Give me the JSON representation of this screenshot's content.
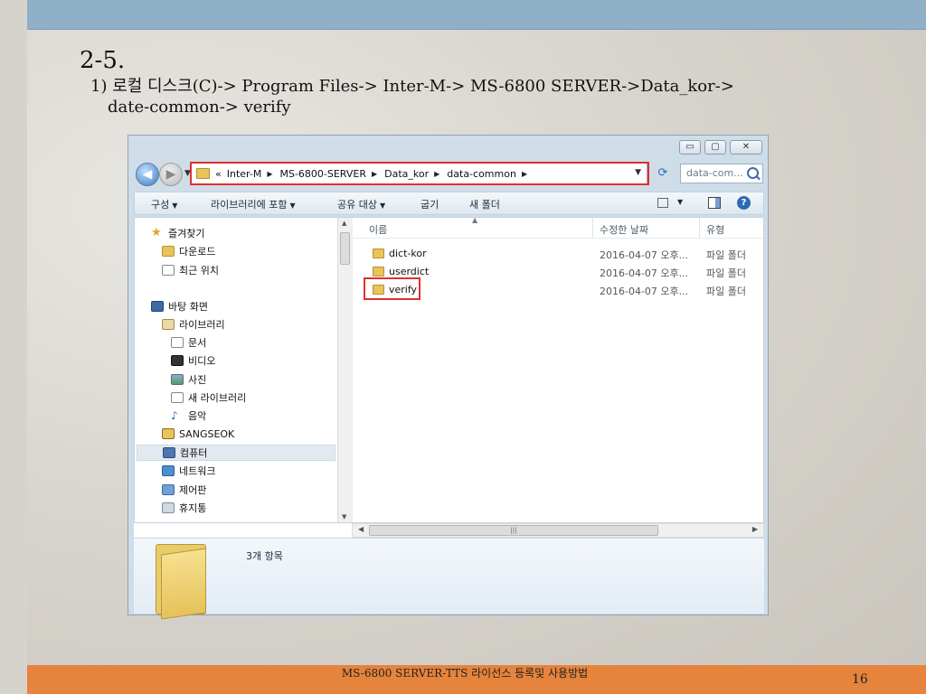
{
  "slide": {
    "title": "2-5.",
    "subtitle_line1": "1) 로컬 디스크(C)-> Program Files-> Inter-M-> MS-6800 SERVER->Data_kor->",
    "subtitle_line2": "date-common-> verify",
    "footer": "MS-6800 SERVER-TTS 라이선스 등록및 사용방법",
    "page_number": "16"
  },
  "explorer": {
    "window_controls": {
      "minimize": "▭",
      "maximize": "▢",
      "close": "✕"
    },
    "address": {
      "prefix": "«",
      "crumbs": [
        "Inter-M",
        "MS-6800-SERVER",
        "Data_kor",
        "data-common"
      ]
    },
    "search_placeholder": "data-com...",
    "toolbar": {
      "organize": "구성",
      "include_library": "라이브러리에 포함",
      "share_with": "공유 대상",
      "burn": "굽기",
      "new_folder": "새 폴더"
    },
    "nav_pane": [
      {
        "label": "즐겨찾기",
        "icon": "star-icon"
      },
      {
        "label": "다운로드",
        "icon": "downloads-folder-icon"
      },
      {
        "label": "최근 위치",
        "icon": "recent-places-icon"
      },
      {
        "label": "바탕 화면",
        "icon": "desktop-icon"
      },
      {
        "label": "라이브러리",
        "icon": "library-icon"
      },
      {
        "label": "문서",
        "icon": "documents-icon"
      },
      {
        "label": "비디오",
        "icon": "videos-icon"
      },
      {
        "label": "사진",
        "icon": "pictures-icon"
      },
      {
        "label": "새 라이브러리",
        "icon": "new-library-icon"
      },
      {
        "label": "음악",
        "icon": "music-icon"
      },
      {
        "label": "SANGSEOK",
        "icon": "user-folder-icon"
      },
      {
        "label": "컴퓨터",
        "icon": "computer-icon"
      },
      {
        "label": "네트워크",
        "icon": "network-icon"
      },
      {
        "label": "제어판",
        "icon": "control-panel-icon"
      },
      {
        "label": "휴지통",
        "icon": "recycle-bin-icon"
      }
    ],
    "columns": {
      "name": "이름",
      "modified": "수정한 날짜",
      "type": "유형"
    },
    "files": [
      {
        "name": "dict-kor",
        "modified": "2016-04-07 오후...",
        "type": "파일 폴더"
      },
      {
        "name": "userdict",
        "modified": "2016-04-07 오후...",
        "type": "파일 폴더"
      },
      {
        "name": "verify",
        "modified": "2016-04-07 오후...",
        "type": "파일 폴더"
      }
    ],
    "item_count": "3개 항목"
  }
}
